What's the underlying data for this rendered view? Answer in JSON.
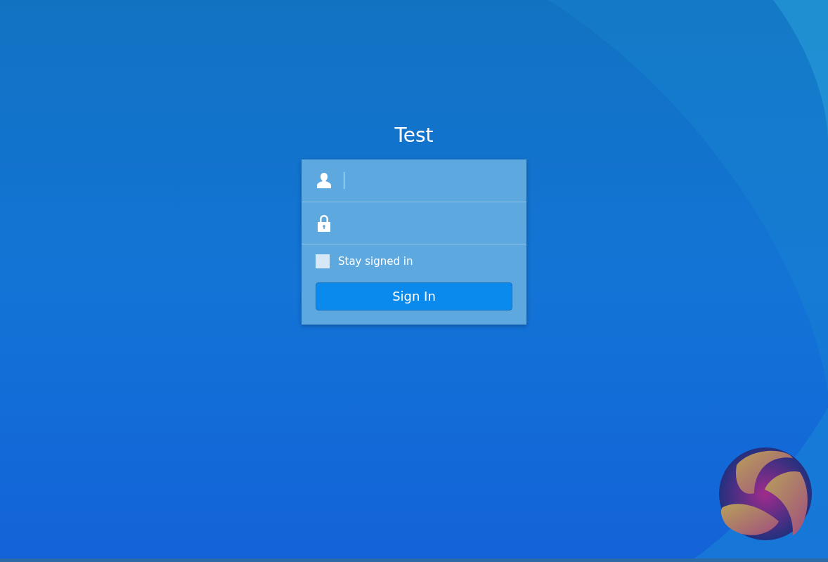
{
  "title": "Test",
  "fields": [
    {
      "kind": "username",
      "focused": true
    },
    {
      "kind": "password",
      "focused": false
    }
  ],
  "stay_signed_in": {
    "label": "Stay signed in",
    "checked": false
  },
  "sign_in_button": {
    "label": "Sign In"
  }
}
